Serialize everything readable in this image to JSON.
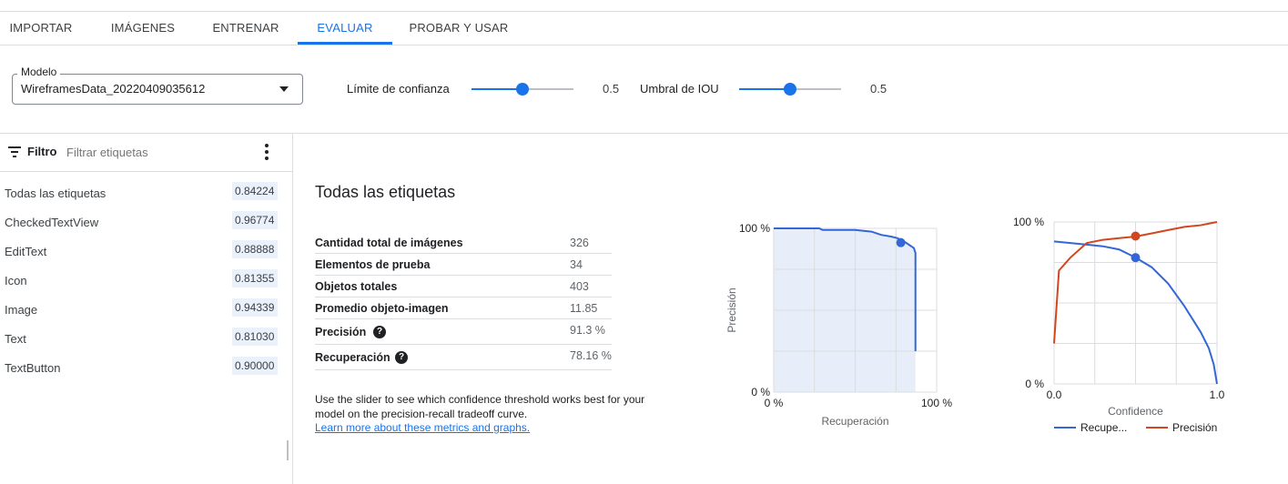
{
  "tabs": [
    {
      "label": "IMPORTAR"
    },
    {
      "label": "IMÁGENES"
    },
    {
      "label": "ENTRENAR"
    },
    {
      "label": "EVALUAR"
    },
    {
      "label": "PROBAR Y USAR"
    }
  ],
  "active_tab": "EVALUAR",
  "model": {
    "label": "Modelo",
    "value": "WireframesData_20220409035612"
  },
  "confidence_slider": {
    "label": "Límite de confianza",
    "value_text": "0.5",
    "value": 0.5
  },
  "iou_slider": {
    "label": "Umbral de IOU",
    "value_text": "0.5",
    "value": 0.5
  },
  "sidebar": {
    "filter_title": "Filtro",
    "filter_placeholder": "Filtrar etiquetas",
    "labels": [
      {
        "name": "Todas las etiquetas",
        "score": "0.84224"
      },
      {
        "name": "CheckedTextView",
        "score": "0.96774"
      },
      {
        "name": "EditText",
        "score": "0.88888"
      },
      {
        "name": "Icon",
        "score": "0.81355"
      },
      {
        "name": "Image",
        "score": "0.94339"
      },
      {
        "name": "Text",
        "score": "0.81030"
      },
      {
        "name": "TextButton",
        "score": "0.90000"
      }
    ]
  },
  "main": {
    "title": "Todas las etiquetas",
    "stats": [
      {
        "label": "Cantidad total de imágenes",
        "value": "326"
      },
      {
        "label": "Elementos de prueba",
        "value": "34"
      },
      {
        "label": "Objetos totales",
        "value": "403"
      },
      {
        "label": "Promedio objeto-imagen",
        "value": "11.85"
      },
      {
        "label": "Precisión",
        "value": "91.3 %"
      },
      {
        "label": "Recuperación",
        "value": "78.16 %"
      }
    ],
    "help_glyph": "?",
    "description": "Use the slider to see which confidence threshold works best for your model on the precision-recall tradeoff curve.",
    "learn_more": "Learn more about these metrics and graphs."
  },
  "chart_data": [
    {
      "type": "area",
      "xlabel": "Recuperación",
      "ylabel": "Precisión",
      "x_tick_labels": [
        "0 %",
        "100 %"
      ],
      "y_tick_labels": [
        "0 %",
        "100 %"
      ],
      "xlim": [
        0,
        1
      ],
      "ylim": [
        0,
        1
      ],
      "grid": true,
      "series": [
        {
          "x": [
            0,
            0.28,
            0.3,
            0.5,
            0.6,
            0.66,
            0.72,
            0.76,
            0.8,
            0.83,
            0.86,
            0.87,
            0.87
          ],
          "y": [
            1,
            1,
            0.99,
            0.99,
            0.98,
            0.96,
            0.95,
            0.94,
            0.92,
            0.9,
            0.88,
            0.85,
            0.25
          ]
        }
      ],
      "highlight_point": {
        "x": 0.78,
        "y": 0.913
      },
      "colors": {
        "line": "#3367d6",
        "fill": "#e8eef9",
        "point": "#3367d6"
      }
    },
    {
      "type": "line",
      "xlabel": "Confidence",
      "x_tick_labels": [
        "0.0",
        "1.0"
      ],
      "y_tick_labels": [
        "0 %",
        "100 %"
      ],
      "xlim": [
        0,
        1
      ],
      "ylim": [
        0,
        1
      ],
      "grid": true,
      "legend": "bottom",
      "series": [
        {
          "name": "Recupe...",
          "x": [
            0,
            0.1,
            0.2,
            0.3,
            0.4,
            0.5,
            0.6,
            0.7,
            0.75,
            0.8,
            0.85,
            0.9,
            0.95,
            0.98,
            1.0
          ],
          "y": [
            0.88,
            0.87,
            0.86,
            0.85,
            0.83,
            0.78,
            0.72,
            0.62,
            0.55,
            0.48,
            0.4,
            0.32,
            0.22,
            0.12,
            0.0
          ]
        },
        {
          "name": "Precisión",
          "x": [
            0,
            0.03,
            0.1,
            0.2,
            0.3,
            0.4,
            0.5,
            0.6,
            0.7,
            0.8,
            0.9,
            0.95,
            1.0
          ],
          "y": [
            0.25,
            0.7,
            0.78,
            0.87,
            0.89,
            0.9,
            0.91,
            0.93,
            0.95,
            0.97,
            0.98,
            0.99,
            1.0
          ]
        }
      ],
      "highlight_points": [
        {
          "x": 0.5,
          "y": 0.78
        },
        {
          "x": 0.5,
          "y": 0.913
        }
      ],
      "colors": {
        "recall": "#3367d6",
        "precision": "#d2461f"
      }
    }
  ]
}
